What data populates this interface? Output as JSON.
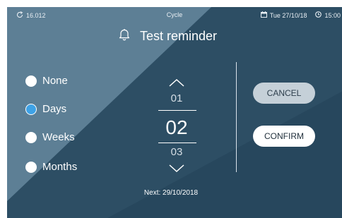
{
  "statusbar": {
    "left_icon": "refresh-icon",
    "left_value": "16.012",
    "center": "Cycle",
    "date_icon": "calendar-icon",
    "date": "Tue 27/10/18",
    "time_icon": "clock-icon",
    "time": "15:00"
  },
  "title": {
    "icon": "bell-icon",
    "text": "Test reminder"
  },
  "repeat_options": [
    {
      "label": "None",
      "selected": false
    },
    {
      "label": "Days",
      "selected": true
    },
    {
      "label": "Weeks",
      "selected": false
    },
    {
      "label": "Months",
      "selected": false
    }
  ],
  "picker": {
    "up_icon": "chevron-up-icon",
    "prev": "01",
    "current": "02",
    "next": "03",
    "down_icon": "chevron-down-icon"
  },
  "buttons": {
    "cancel": "CANCEL",
    "confirm": "CONFIRM"
  },
  "next_date": "Next: 29/10/2018",
  "colors": {
    "background_dark": "#2d4e64",
    "background_light": "#5d7f95",
    "selected_radio": "#3ea2e6",
    "cancel_button": "#c5d0d8",
    "confirm_button": "#ffffff"
  }
}
